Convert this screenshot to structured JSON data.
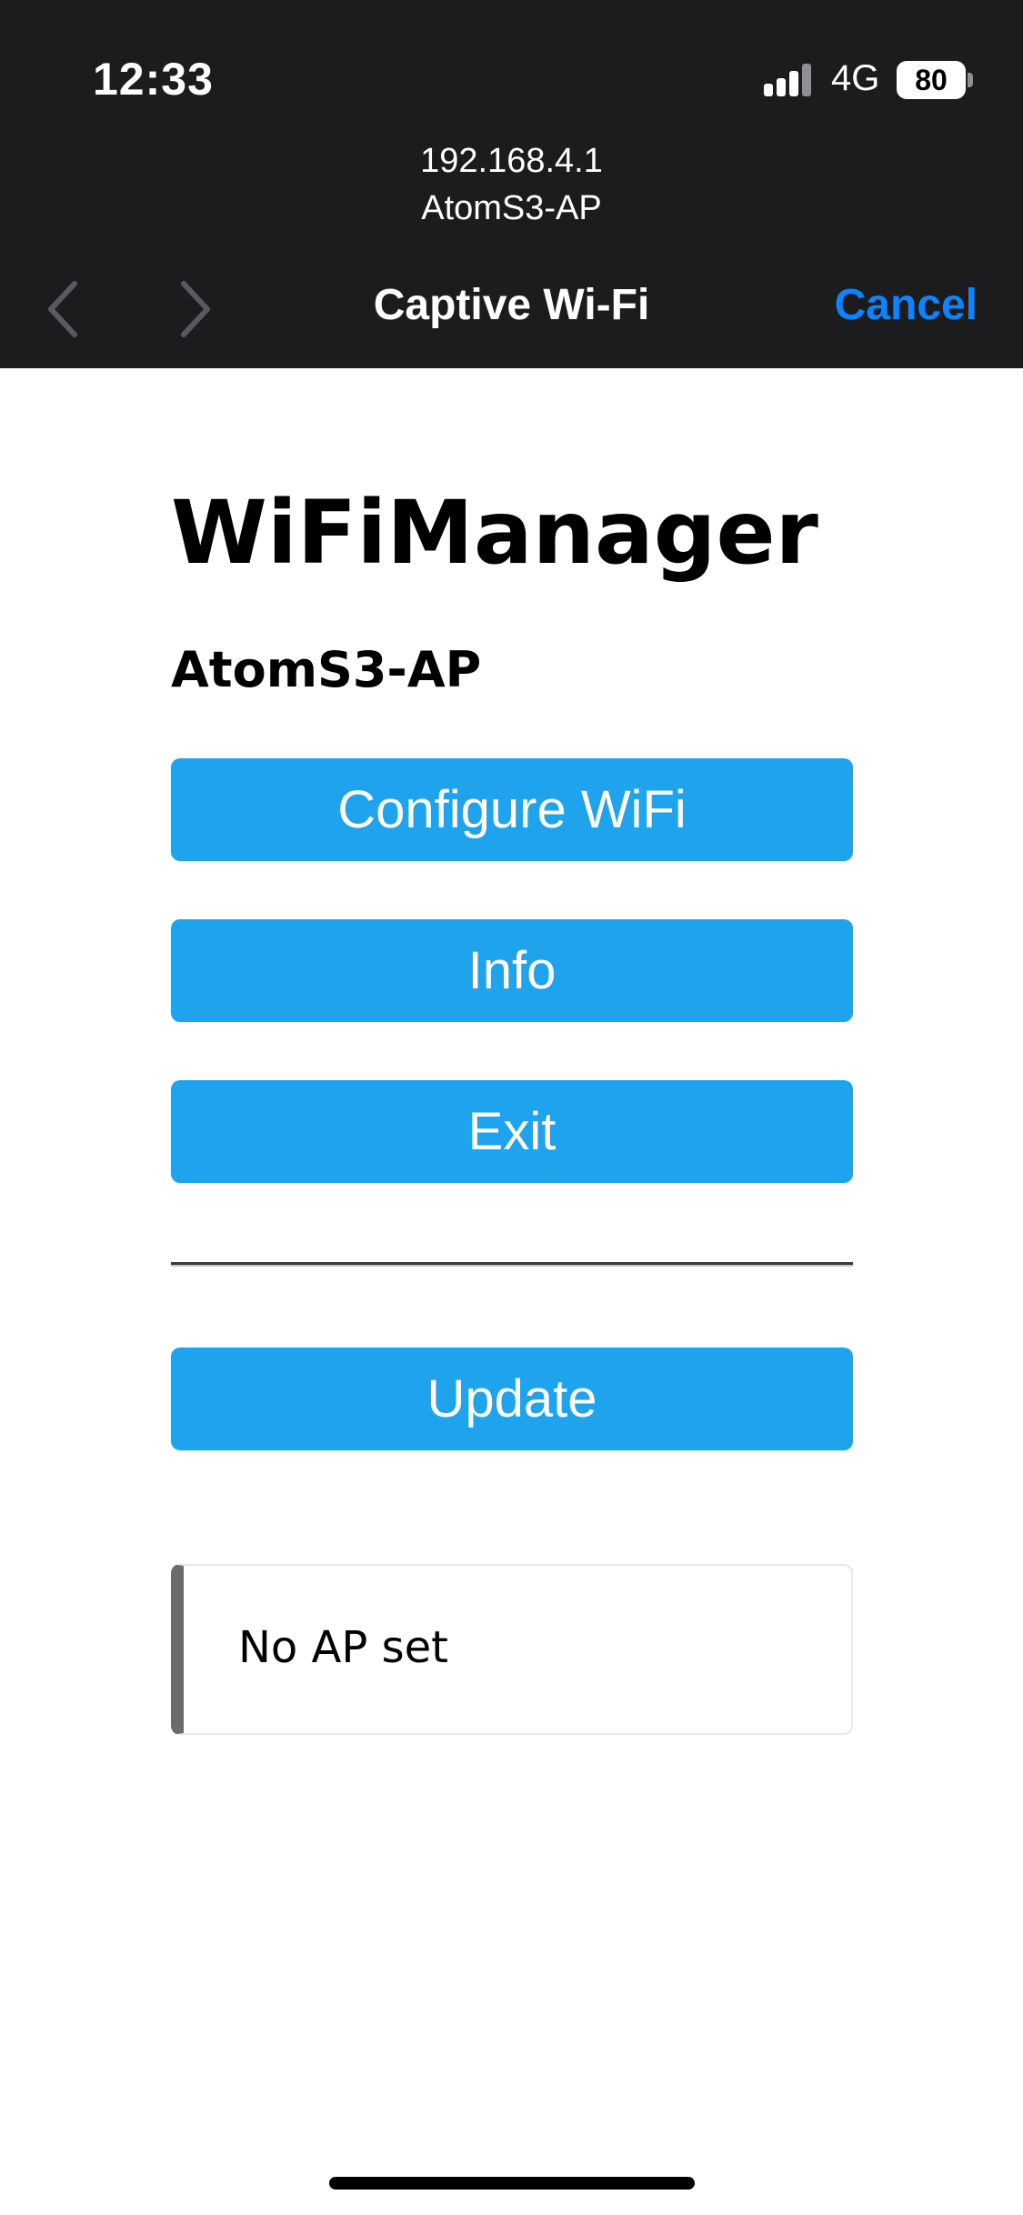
{
  "status_bar": {
    "time": "12:33",
    "network": "4G",
    "battery": "80"
  },
  "browser": {
    "url": "192.168.4.1",
    "host": "AtomS3-AP",
    "title": "Captive Wi-Fi",
    "cancel_label": "Cancel",
    "accent_color": "#0a84ff"
  },
  "page": {
    "heading": "WiFiManager",
    "subheading": "AtomS3-AP",
    "buttons": [
      {
        "label": "Configure WiFi"
      },
      {
        "label": "Info"
      },
      {
        "label": "Exit"
      }
    ],
    "update_label": "Update",
    "message": "No AP set",
    "button_color": "#1fa3ec"
  }
}
